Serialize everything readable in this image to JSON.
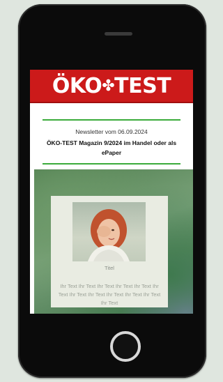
{
  "brand": {
    "logo_text": "ÖKO",
    "logo_leaf": "✤",
    "logo_text_2": "TEST",
    "color": "#cc1a1a"
  },
  "newsletter": {
    "date_line": "Newsletter vom 06.09.2024",
    "headline": "ÖKO-TEST Magazin 9/2024 im Handel oder als ePaper",
    "rule_color": "#3bab3b"
  },
  "hero_card": {
    "image_icon": "woman-portrait-image",
    "caption": "Titel",
    "body": "Ihr Text Ihr Text Ihr Text Ihr Text Ihr Text Ihr Text Ihr Text Ihr Text Ihr Text Ihr Text Ihr Text Ihr Text"
  }
}
